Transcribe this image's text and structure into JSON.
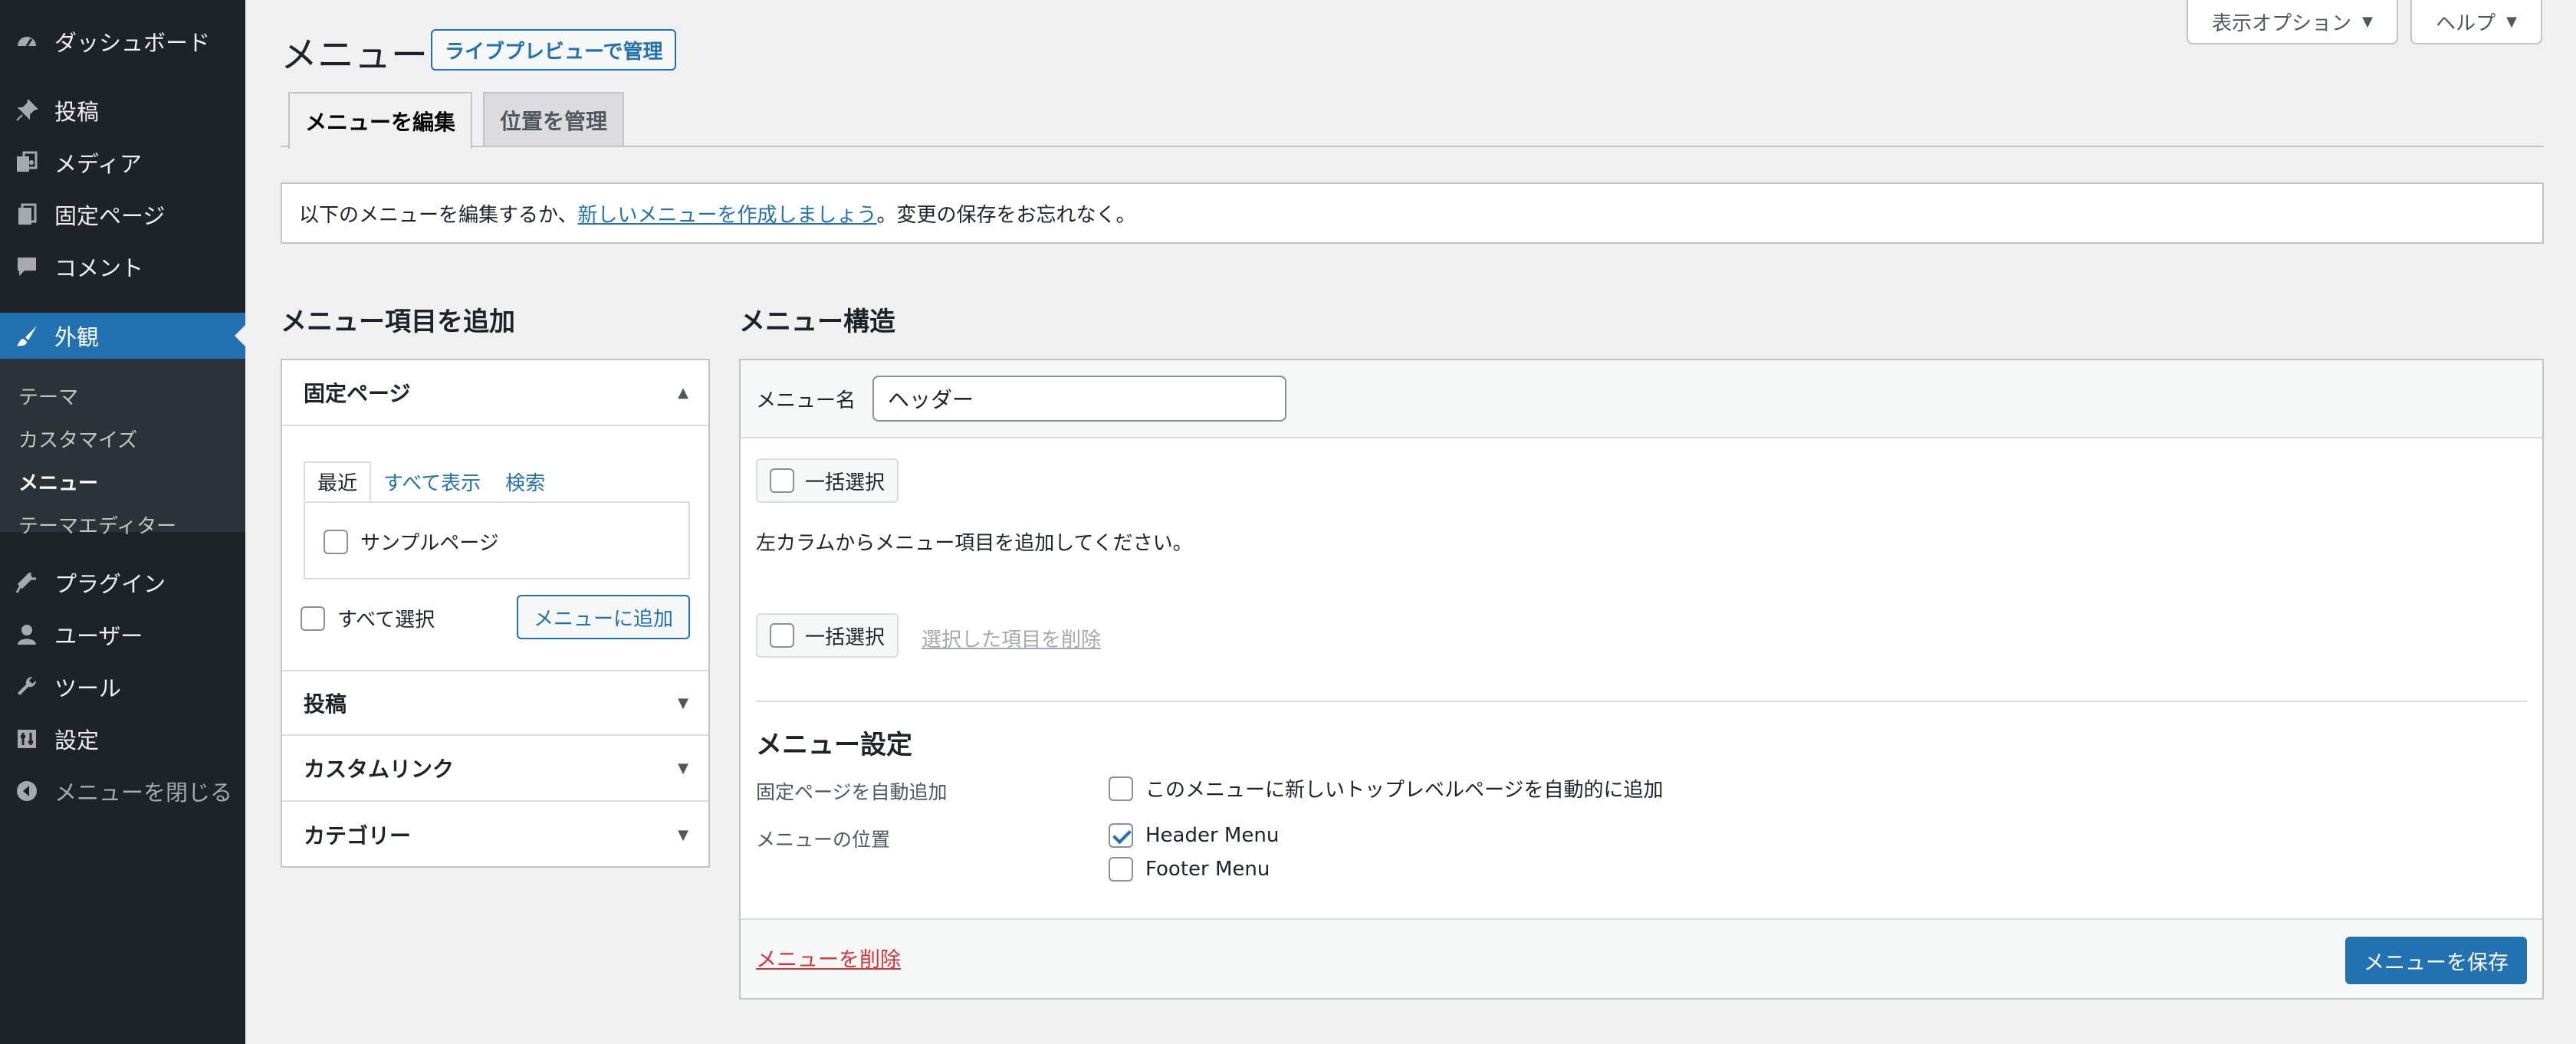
{
  "sidebar": {
    "items": [
      {
        "label": "ダッシュボード",
        "icon": "dashboard-icon"
      },
      {
        "label": "投稿",
        "icon": "pin-icon"
      },
      {
        "label": "メディア",
        "icon": "media-icon"
      },
      {
        "label": "固定ページ",
        "icon": "page-icon"
      },
      {
        "label": "コメント",
        "icon": "comment-icon"
      },
      {
        "label": "外観",
        "icon": "appearance-icon"
      },
      {
        "label": "プラグイン",
        "icon": "plugin-icon"
      },
      {
        "label": "ユーザー",
        "icon": "user-icon"
      },
      {
        "label": "ツール",
        "icon": "tool-icon"
      },
      {
        "label": "設定",
        "icon": "settings-icon"
      },
      {
        "label": "メニューを閉じる",
        "icon": "collapse-icon"
      }
    ],
    "submenu": [
      "テーマ",
      "カスタマイズ",
      "メニュー",
      "テーマエディター"
    ]
  },
  "screen_options": {
    "display": "表示オプション",
    "help": "ヘルプ"
  },
  "header": {
    "title": "メニュー",
    "live_preview": "ライブプレビューで管理"
  },
  "tabs": [
    "メニューを編集",
    "位置を管理"
  ],
  "notice": {
    "before": "以下のメニューを編集するか、",
    "link": "新しいメニューを作成しましょう",
    "after": "。変更の保存をお忘れなく。"
  },
  "add_items": {
    "heading": "メニュー項目を追加",
    "sections": [
      "固定ページ",
      "投稿",
      "カスタムリンク",
      "カテゴリー"
    ],
    "subtabs": [
      "最近",
      "すべて表示",
      "検索"
    ],
    "pages": [
      "サンプルページ"
    ],
    "select_all": "すべて選択",
    "add_button": "メニューに追加"
  },
  "structure": {
    "heading": "メニュー構造",
    "menu_name_label": "メニュー名",
    "menu_name_value": "ヘッダー",
    "bulk_select": "一括選択",
    "instruction": "左カラムからメニュー項目を追加してください。",
    "remove_selected": "選択した項目を削除",
    "settings_heading": "メニュー設定",
    "auto_add_label": "固定ページを自動追加",
    "auto_add_option": "このメニューに新しいトップレベルページを自動的に追加",
    "location_label": "メニューの位置",
    "locations": [
      {
        "label": "Header Menu",
        "checked": true
      },
      {
        "label": "Footer Menu",
        "checked": false
      }
    ],
    "delete_menu": "メニューを削除",
    "save_menu": "メニューを保存"
  },
  "colors": {
    "accent": "#2271b1",
    "sidebar": "#1d2327",
    "danger": "#d63638"
  }
}
